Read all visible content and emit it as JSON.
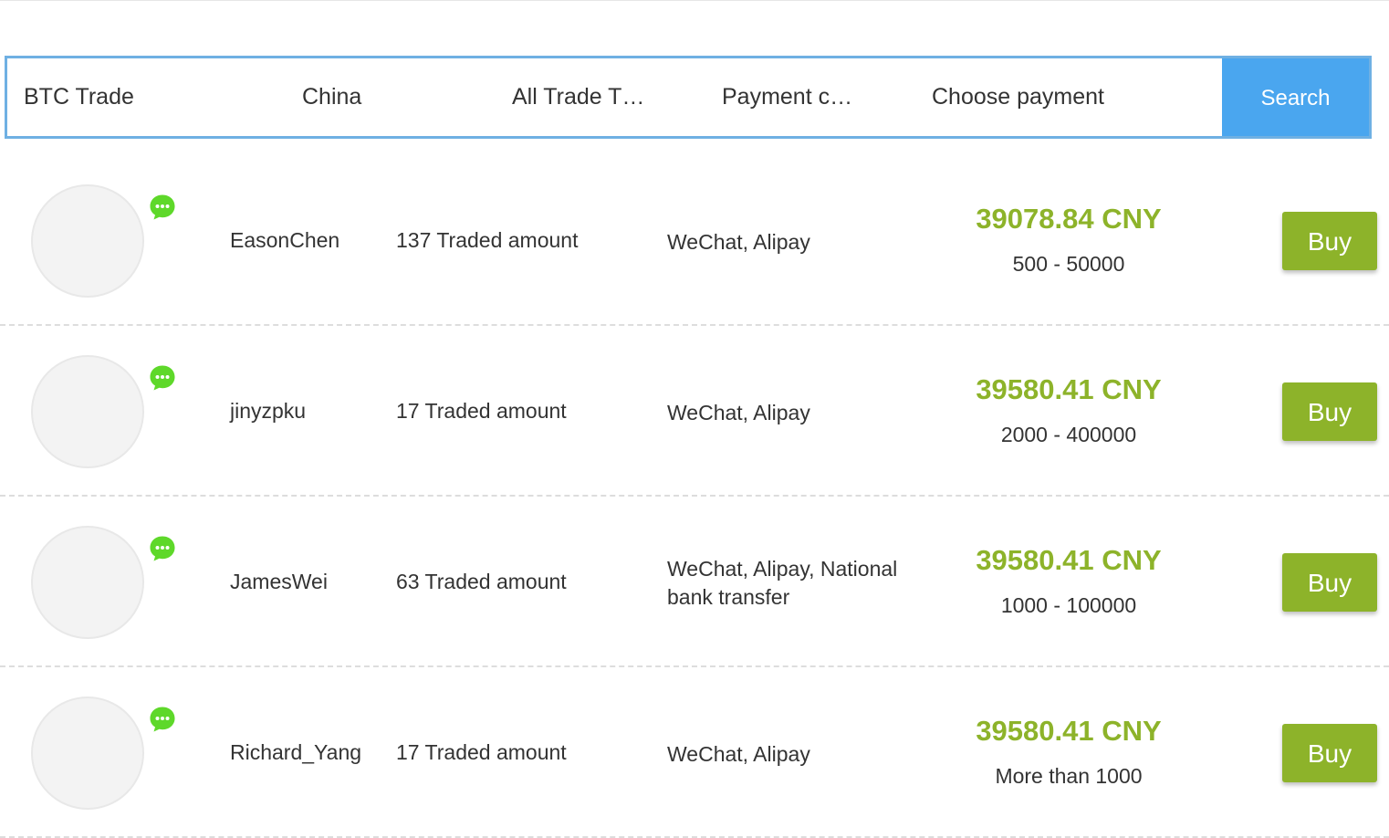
{
  "filters": {
    "coin": "BTC Trade",
    "country": "China",
    "trade_type": "All Trade T…",
    "payment_currency": "Payment c…",
    "payment_method": "Choose payment",
    "search_label": "Search"
  },
  "colors": {
    "accent_blue": "#4aa6ef",
    "price_green": "#8db32a",
    "chat_green": "#5ed82a"
  },
  "offers": [
    {
      "user": "EasonChen",
      "traded": "137 Traded amount",
      "payment": "WeChat, Alipay",
      "price": "39078.84 CNY",
      "limit": "500 - 50000",
      "buy_label": "Buy"
    },
    {
      "user": "jinyzpku",
      "traded": "17 Traded amount",
      "payment": "WeChat, Alipay",
      "price": "39580.41 CNY",
      "limit": "2000 - 400000",
      "buy_label": "Buy"
    },
    {
      "user": "JamesWei",
      "traded": "63 Traded amount",
      "payment": "WeChat, Alipay, National bank transfer",
      "price": "39580.41 CNY",
      "limit": "1000 - 100000",
      "buy_label": "Buy"
    },
    {
      "user": "Richard_Yang",
      "traded": "17 Traded amount",
      "payment": "WeChat, Alipay",
      "price": "39580.41 CNY",
      "limit": "More than 1000",
      "buy_label": "Buy"
    }
  ]
}
